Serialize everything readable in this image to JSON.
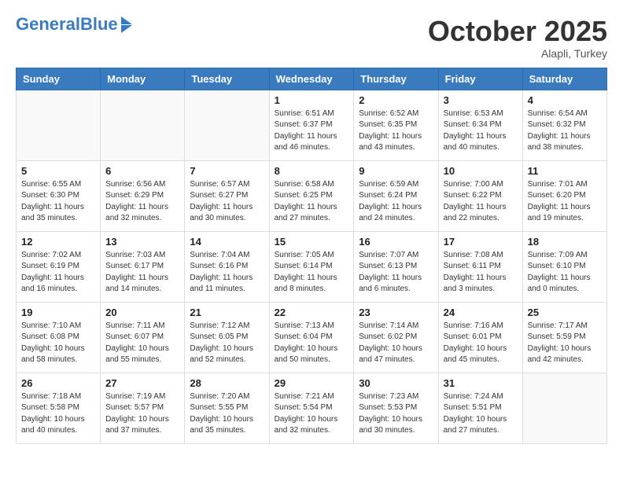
{
  "header": {
    "logo_general": "General",
    "logo_blue": "Blue",
    "month_title": "October 2025",
    "location": "Alapli, Turkey"
  },
  "days_of_week": [
    "Sunday",
    "Monday",
    "Tuesday",
    "Wednesday",
    "Thursday",
    "Friday",
    "Saturday"
  ],
  "weeks": [
    [
      {
        "day": "",
        "info": ""
      },
      {
        "day": "",
        "info": ""
      },
      {
        "day": "",
        "info": ""
      },
      {
        "day": "1",
        "info": "Sunrise: 6:51 AM\nSunset: 6:37 PM\nDaylight: 11 hours\nand 46 minutes."
      },
      {
        "day": "2",
        "info": "Sunrise: 6:52 AM\nSunset: 6:35 PM\nDaylight: 11 hours\nand 43 minutes."
      },
      {
        "day": "3",
        "info": "Sunrise: 6:53 AM\nSunset: 6:34 PM\nDaylight: 11 hours\nand 40 minutes."
      },
      {
        "day": "4",
        "info": "Sunrise: 6:54 AM\nSunset: 6:32 PM\nDaylight: 11 hours\nand 38 minutes."
      }
    ],
    [
      {
        "day": "5",
        "info": "Sunrise: 6:55 AM\nSunset: 6:30 PM\nDaylight: 11 hours\nand 35 minutes."
      },
      {
        "day": "6",
        "info": "Sunrise: 6:56 AM\nSunset: 6:29 PM\nDaylight: 11 hours\nand 32 minutes."
      },
      {
        "day": "7",
        "info": "Sunrise: 6:57 AM\nSunset: 6:27 PM\nDaylight: 11 hours\nand 30 minutes."
      },
      {
        "day": "8",
        "info": "Sunrise: 6:58 AM\nSunset: 6:25 PM\nDaylight: 11 hours\nand 27 minutes."
      },
      {
        "day": "9",
        "info": "Sunrise: 6:59 AM\nSunset: 6:24 PM\nDaylight: 11 hours\nand 24 minutes."
      },
      {
        "day": "10",
        "info": "Sunrise: 7:00 AM\nSunset: 6:22 PM\nDaylight: 11 hours\nand 22 minutes."
      },
      {
        "day": "11",
        "info": "Sunrise: 7:01 AM\nSunset: 6:20 PM\nDaylight: 11 hours\nand 19 minutes."
      }
    ],
    [
      {
        "day": "12",
        "info": "Sunrise: 7:02 AM\nSunset: 6:19 PM\nDaylight: 11 hours\nand 16 minutes."
      },
      {
        "day": "13",
        "info": "Sunrise: 7:03 AM\nSunset: 6:17 PM\nDaylight: 11 hours\nand 14 minutes."
      },
      {
        "day": "14",
        "info": "Sunrise: 7:04 AM\nSunset: 6:16 PM\nDaylight: 11 hours\nand 11 minutes."
      },
      {
        "day": "15",
        "info": "Sunrise: 7:05 AM\nSunset: 6:14 PM\nDaylight: 11 hours\nand 8 minutes."
      },
      {
        "day": "16",
        "info": "Sunrise: 7:07 AM\nSunset: 6:13 PM\nDaylight: 11 hours\nand 6 minutes."
      },
      {
        "day": "17",
        "info": "Sunrise: 7:08 AM\nSunset: 6:11 PM\nDaylight: 11 hours\nand 3 minutes."
      },
      {
        "day": "18",
        "info": "Sunrise: 7:09 AM\nSunset: 6:10 PM\nDaylight: 11 hours\nand 0 minutes."
      }
    ],
    [
      {
        "day": "19",
        "info": "Sunrise: 7:10 AM\nSunset: 6:08 PM\nDaylight: 10 hours\nand 58 minutes."
      },
      {
        "day": "20",
        "info": "Sunrise: 7:11 AM\nSunset: 6:07 PM\nDaylight: 10 hours\nand 55 minutes."
      },
      {
        "day": "21",
        "info": "Sunrise: 7:12 AM\nSunset: 6:05 PM\nDaylight: 10 hours\nand 52 minutes."
      },
      {
        "day": "22",
        "info": "Sunrise: 7:13 AM\nSunset: 6:04 PM\nDaylight: 10 hours\nand 50 minutes."
      },
      {
        "day": "23",
        "info": "Sunrise: 7:14 AM\nSunset: 6:02 PM\nDaylight: 10 hours\nand 47 minutes."
      },
      {
        "day": "24",
        "info": "Sunrise: 7:16 AM\nSunset: 6:01 PM\nDaylight: 10 hours\nand 45 minutes."
      },
      {
        "day": "25",
        "info": "Sunrise: 7:17 AM\nSunset: 5:59 PM\nDaylight: 10 hours\nand 42 minutes."
      }
    ],
    [
      {
        "day": "26",
        "info": "Sunrise: 7:18 AM\nSunset: 5:58 PM\nDaylight: 10 hours\nand 40 minutes."
      },
      {
        "day": "27",
        "info": "Sunrise: 7:19 AM\nSunset: 5:57 PM\nDaylight: 10 hours\nand 37 minutes."
      },
      {
        "day": "28",
        "info": "Sunrise: 7:20 AM\nSunset: 5:55 PM\nDaylight: 10 hours\nand 35 minutes."
      },
      {
        "day": "29",
        "info": "Sunrise: 7:21 AM\nSunset: 5:54 PM\nDaylight: 10 hours\nand 32 minutes."
      },
      {
        "day": "30",
        "info": "Sunrise: 7:23 AM\nSunset: 5:53 PM\nDaylight: 10 hours\nand 30 minutes."
      },
      {
        "day": "31",
        "info": "Sunrise: 7:24 AM\nSunset: 5:51 PM\nDaylight: 10 hours\nand 27 minutes."
      },
      {
        "day": "",
        "info": ""
      }
    ]
  ]
}
